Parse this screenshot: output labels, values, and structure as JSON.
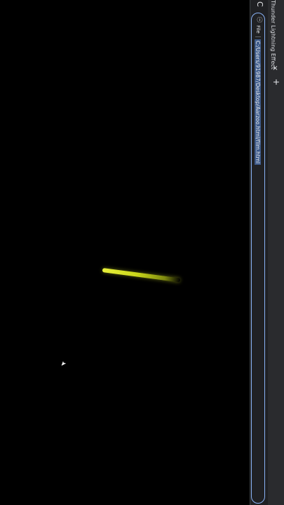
{
  "browser": {
    "tab_title": "Thunder Lightning Effect",
    "tab_close_icon": "×",
    "new_tab_icon": "+",
    "reload_icon": "C",
    "info_icon": "ⓘ",
    "url_scheme": "File",
    "url": "C:/Users/91987/Desktop/Aarzoo.html/film.html"
  },
  "canvas": {
    "background": "#000000",
    "bolt_color": "#e8f03a"
  },
  "icons": {
    "cursor": "mouse-pointer-icon"
  }
}
